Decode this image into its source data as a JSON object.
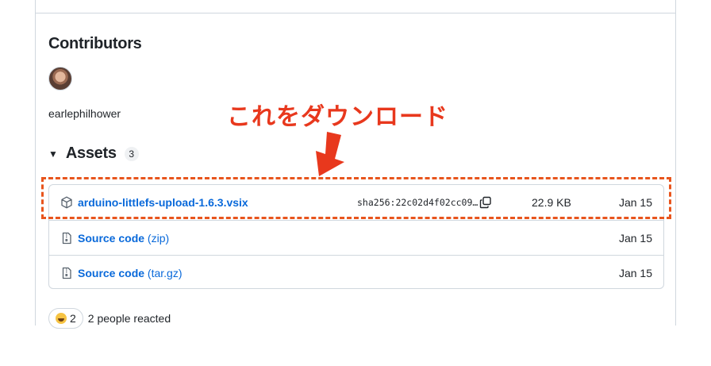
{
  "contributors": {
    "title": "Contributors",
    "users": [
      {
        "username": "earlephilhower"
      }
    ]
  },
  "annotation": {
    "text": "これをダウンロード",
    "color": "#e8381d"
  },
  "assets": {
    "title": "Assets",
    "count": "3",
    "items": [
      {
        "icon": "package-icon",
        "name": "arduino-littlefs-upload-1.6.3.vsix",
        "suffix": "",
        "sha": "sha256:22c02d4f02cc09…",
        "size": "22.9 KB",
        "date": "Jan 15"
      },
      {
        "icon": "file-zip-icon",
        "name": "Source code",
        "suffix": "(zip)",
        "date": "Jan 15"
      },
      {
        "icon": "file-zip-icon",
        "name": "Source code",
        "suffix": "(tar.gz)",
        "date": "Jan 15"
      }
    ]
  },
  "reactions": {
    "emoji": "smile-emoji",
    "count": "2",
    "summary": "2 people reacted"
  },
  "colors": {
    "link": "#0969da",
    "border": "#d0d7de",
    "highlight": "#e8551d"
  }
}
